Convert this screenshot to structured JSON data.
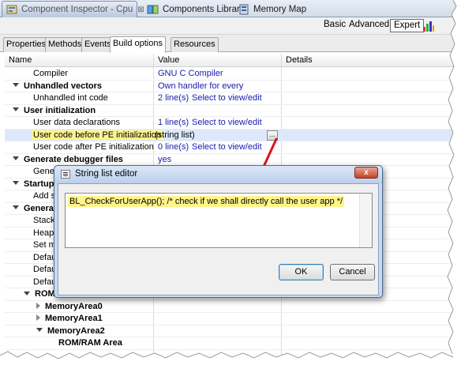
{
  "editor_tabs": [
    {
      "label": "Component Inspector - Cpu",
      "close": "⊠",
      "active": true
    },
    {
      "label": "Components Library",
      "active": false
    },
    {
      "label": "Memory Map",
      "active": false
    }
  ],
  "toolbar": {
    "modes": [
      "Basic",
      "Advanced",
      "Expert"
    ],
    "selected_mode": "Expert"
  },
  "sub_tabs": [
    "Properties",
    "Methods",
    "Events",
    "Build options",
    "Resources"
  ],
  "active_sub_tab": "Build options",
  "grid": {
    "columns": {
      "name": "Name",
      "value": "Value",
      "details": "Details"
    },
    "rows": [
      {
        "name": "Compiler",
        "value": "GNU C Compiler",
        "details": ""
      },
      {
        "name": "Unhandled vectors",
        "value": "Own handler for every",
        "details": ""
      },
      {
        "name": "Unhandled int code",
        "value": "2 line(s)",
        "details": "Select to view/edit"
      },
      {
        "name": "User initialization",
        "value": "",
        "details": ""
      },
      {
        "name": "User data declarations",
        "value": "1 line(s)",
        "details": "Select to view/edit"
      },
      {
        "name": "User code before PE initialization",
        "value": "(string list)",
        "details": "..."
      },
      {
        "name": "User code after PE initialization",
        "value": "0 line(s)",
        "details": "Select to view/edit"
      },
      {
        "name": "Generate debugger files",
        "value": "yes",
        "details": ""
      },
      {
        "name": "Gener",
        "value": "",
        "details": ""
      },
      {
        "name": "Startup",
        "value": "",
        "details": ""
      },
      {
        "name": "Add s",
        "value": "",
        "details": ""
      },
      {
        "name": "Genera",
        "value": "",
        "details": ""
      },
      {
        "name": "Stack",
        "value": "",
        "details": ""
      },
      {
        "name": "Heap",
        "value": "",
        "details": ""
      },
      {
        "name": "Set m",
        "value": "",
        "details": ""
      },
      {
        "name": "Defau",
        "value": "",
        "details": ""
      },
      {
        "name": "Defau",
        "value": "",
        "details": ""
      },
      {
        "name": "Defau",
        "value": "",
        "details": ""
      },
      {
        "name": "ROM",
        "value": "",
        "details": ""
      },
      {
        "name": "MemoryArea0",
        "value": "",
        "details": ""
      },
      {
        "name": "MemoryArea1",
        "value": "",
        "details": ""
      },
      {
        "name": "MemoryArea2",
        "value": "",
        "details": ""
      },
      {
        "name": "ROM/RAM Area",
        "value": "",
        "details": ""
      }
    ]
  },
  "dialog": {
    "title": "String list editor",
    "close_glyph": "x",
    "text": "BL_CheckForUserApp(); /* check if we shall directly call the user app */",
    "ok_label": "OK",
    "cancel_label": "Cancel"
  },
  "colors": {
    "highlight": "#fff48a",
    "value_text": "#1a1ab0",
    "annotation_arrow": "#d9141b",
    "close_button": "#c7432b"
  }
}
